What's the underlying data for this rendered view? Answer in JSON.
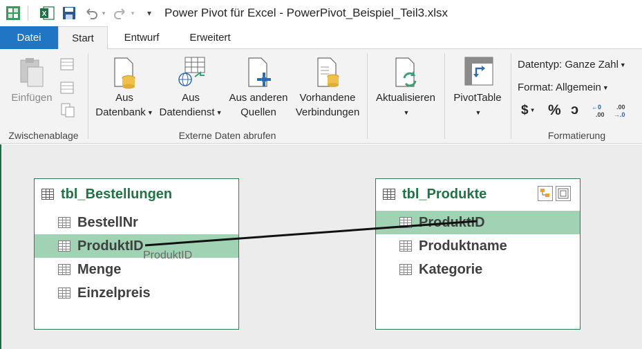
{
  "window": {
    "title": "Power Pivot für Excel - PowerPivot_Beispiel_Teil3.xlsx"
  },
  "tabs": [
    {
      "label": "Datei"
    },
    {
      "label": "Start"
    },
    {
      "label": "Entwurf"
    },
    {
      "label": "Erweitert"
    }
  ],
  "ribbon": {
    "clipboard": {
      "paste_label": "Einfügen",
      "group_label": "Zwischenablage"
    },
    "external": {
      "from_db_line1": "Aus",
      "from_db_line2": "Datenbank",
      "from_service_line1": "Aus",
      "from_service_line2": "Datendienst",
      "from_other_line1": "Aus anderen",
      "from_other_line2": "Quellen",
      "existing_line1": "Vorhandene",
      "existing_line2": "Verbindungen",
      "group_label": "Externe Daten abrufen"
    },
    "refresh": {
      "label": "Aktualisieren"
    },
    "pivot": {
      "label": "PivotTable"
    },
    "format": {
      "datatype": "Datentyp: Ganze Zahl",
      "format": "Format: Allgemein",
      "currency": "$",
      "percent": "%",
      "comma": "ɔ",
      "group_label": "Formatierung"
    }
  },
  "diagram": {
    "tables": [
      {
        "name": "tbl_Bestellungen",
        "fields": [
          "BestellNr",
          "ProduktID",
          "Menge",
          "Einzelpreis"
        ],
        "selected": "ProduktID"
      },
      {
        "name": "tbl_Produkte",
        "fields": [
          "ProduktID",
          "Produktname",
          "Kategorie"
        ],
        "selected": "ProduktID"
      }
    ],
    "relationship_label": "ProduktID"
  },
  "colors": {
    "accent": "#1f76c4",
    "table_header": "#217346",
    "selection": "#9fd3b4",
    "border": "#2f7a4e"
  }
}
